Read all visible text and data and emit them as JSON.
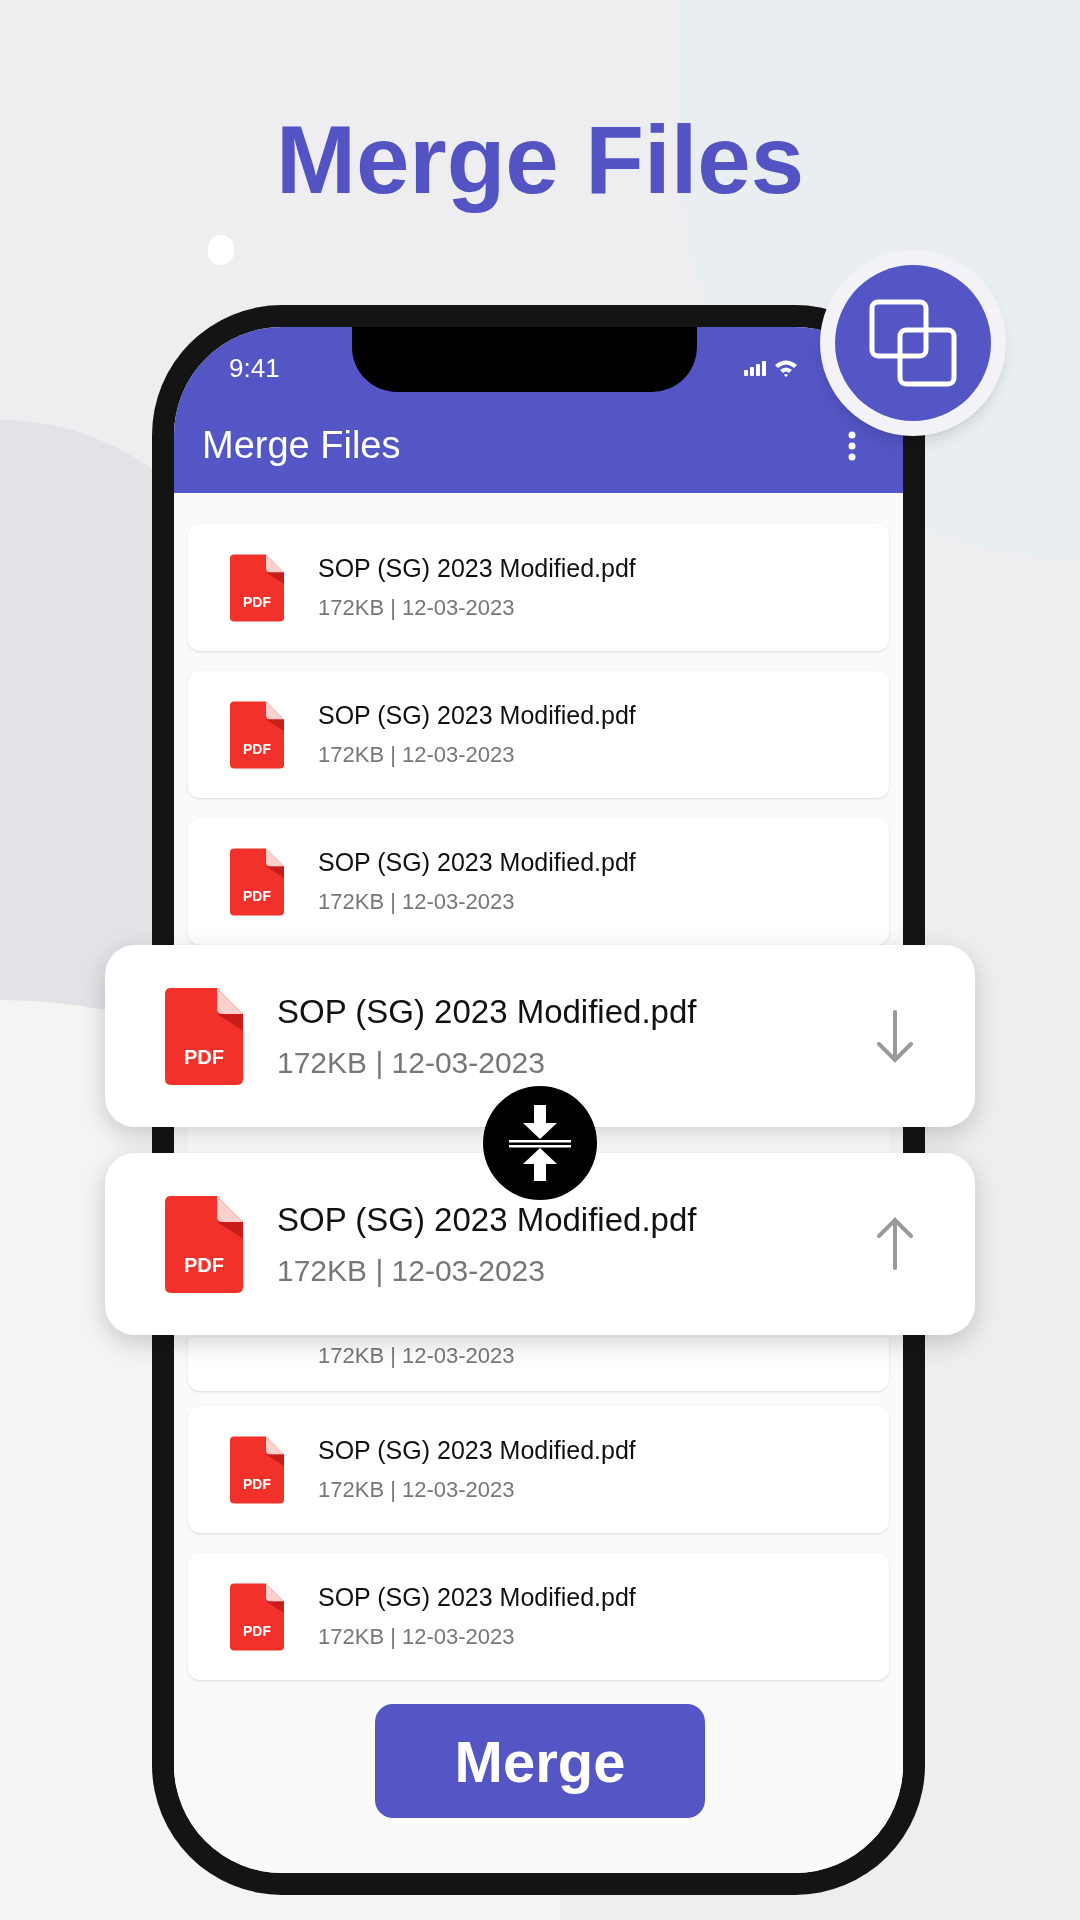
{
  "headline": "Merge Files",
  "status_bar": {
    "time": "9:41"
  },
  "app_bar": {
    "title": "Merge Files"
  },
  "files": [
    {
      "kind": "full",
      "name": "SOP (SG) 2023 Modified.pdf",
      "meta": "172KB | 12-03-2023",
      "icon_label": "PDF"
    },
    {
      "kind": "full",
      "name": "SOP (SG) 2023 Modified.pdf",
      "meta": "172KB | 12-03-2023",
      "icon_label": "PDF"
    },
    {
      "kind": "full",
      "name": "SOP (SG) 2023 Modified.pdf",
      "meta": "172KB | 12-03-2023",
      "icon_label": "PDF"
    },
    {
      "kind": "edge"
    },
    {
      "kind": "tail",
      "meta": "172KB | 12-03-2023"
    },
    {
      "kind": "full",
      "name": "SOP (SG) 2023 Modified.pdf",
      "meta": "172KB | 12-03-2023",
      "icon_label": "PDF"
    },
    {
      "kind": "full",
      "name": "SOP (SG) 2023 Modified.pdf",
      "meta": "172KB | 12-03-2023",
      "icon_label": "PDF"
    }
  ],
  "dragged_files": [
    {
      "name": "SOP (SG) 2023 Modified.pdf",
      "meta": "172KB | 12-03-2023",
      "icon_label": "PDF",
      "moves_down": true
    },
    {
      "name": "SOP (SG) 2023 Modified.pdf",
      "meta": "172KB | 12-03-2023",
      "icon_label": "PDF",
      "moves_down": false
    }
  ],
  "merge_button": "Merge"
}
